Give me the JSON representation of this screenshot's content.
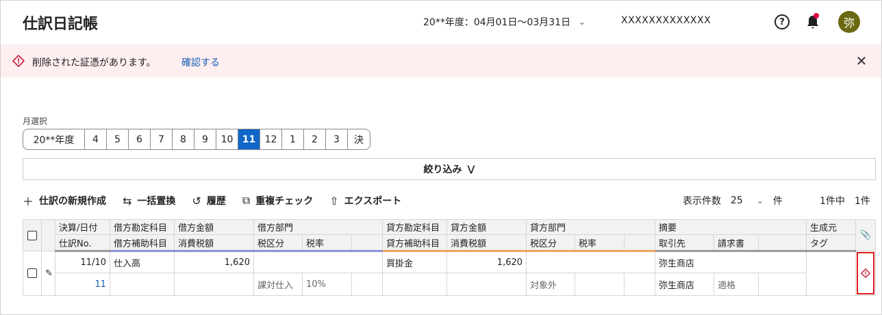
{
  "header": {
    "title": "仕訳日記帳",
    "fiscal_year": "20**年度：04月01日〜03月31日",
    "company": "XXXXXXXXXXXXX",
    "avatar_text": "弥",
    "icons": [
      "help-icon",
      "bell-icon"
    ]
  },
  "alert": {
    "message": "削除された証憑があります。",
    "link": "確認する",
    "color": "#fdeef0"
  },
  "month_selector": {
    "label": "月選択",
    "options": [
      "20**年度",
      "4",
      "5",
      "6",
      "7",
      "8",
      "9",
      "10",
      "11",
      "12",
      "1",
      "2",
      "3",
      "決"
    ],
    "selected": "11",
    "accent": "#1167c8"
  },
  "filter": {
    "label": "絞り込み"
  },
  "toolbar": {
    "new_entry": "仕訳の新規作成",
    "bulk_replace": "一括置換",
    "history": "履歴",
    "duplicate_check": "重複チェック",
    "export": "エクスポート"
  },
  "pagination": {
    "label": "表示件数",
    "per_page": "25",
    "unit": "件",
    "total": "1件中　1件"
  },
  "table": {
    "header_row1": {
      "date": "決算/日付",
      "debit_account": "借方勘定科目",
      "debit_amount": "借方金額",
      "debit_dept": "借方部門",
      "credit_account": "貸方勘定科目",
      "credit_amount": "貸方金額",
      "credit_dept": "貸方部門",
      "memo": "摘要",
      "source": "生成元"
    },
    "header_row2": {
      "entry_no": "仕訳No.",
      "debit_sub": "借方補助科目",
      "debit_tax": "消費税額",
      "debit_tax_class": "税区分",
      "debit_rate": "税率",
      "credit_sub": "貸方補助科目",
      "credit_tax": "消費税額",
      "credit_tax_class": "税区分",
      "credit_rate": "税率",
      "partner": "取引先",
      "invoice": "請求書",
      "tag": "タグ"
    },
    "rows": [
      {
        "date": "11/10",
        "entry_no": "11",
        "debit_account": "仕入高",
        "debit_amount": "1,620",
        "debit_tax_class": "課対仕入",
        "debit_rate": "10%",
        "credit_account": "買掛金",
        "credit_amount": "1,620",
        "credit_tax_class": "対象外",
        "memo": "弥生商店",
        "partner": "弥生商店",
        "invoice": "適格"
      }
    ]
  }
}
